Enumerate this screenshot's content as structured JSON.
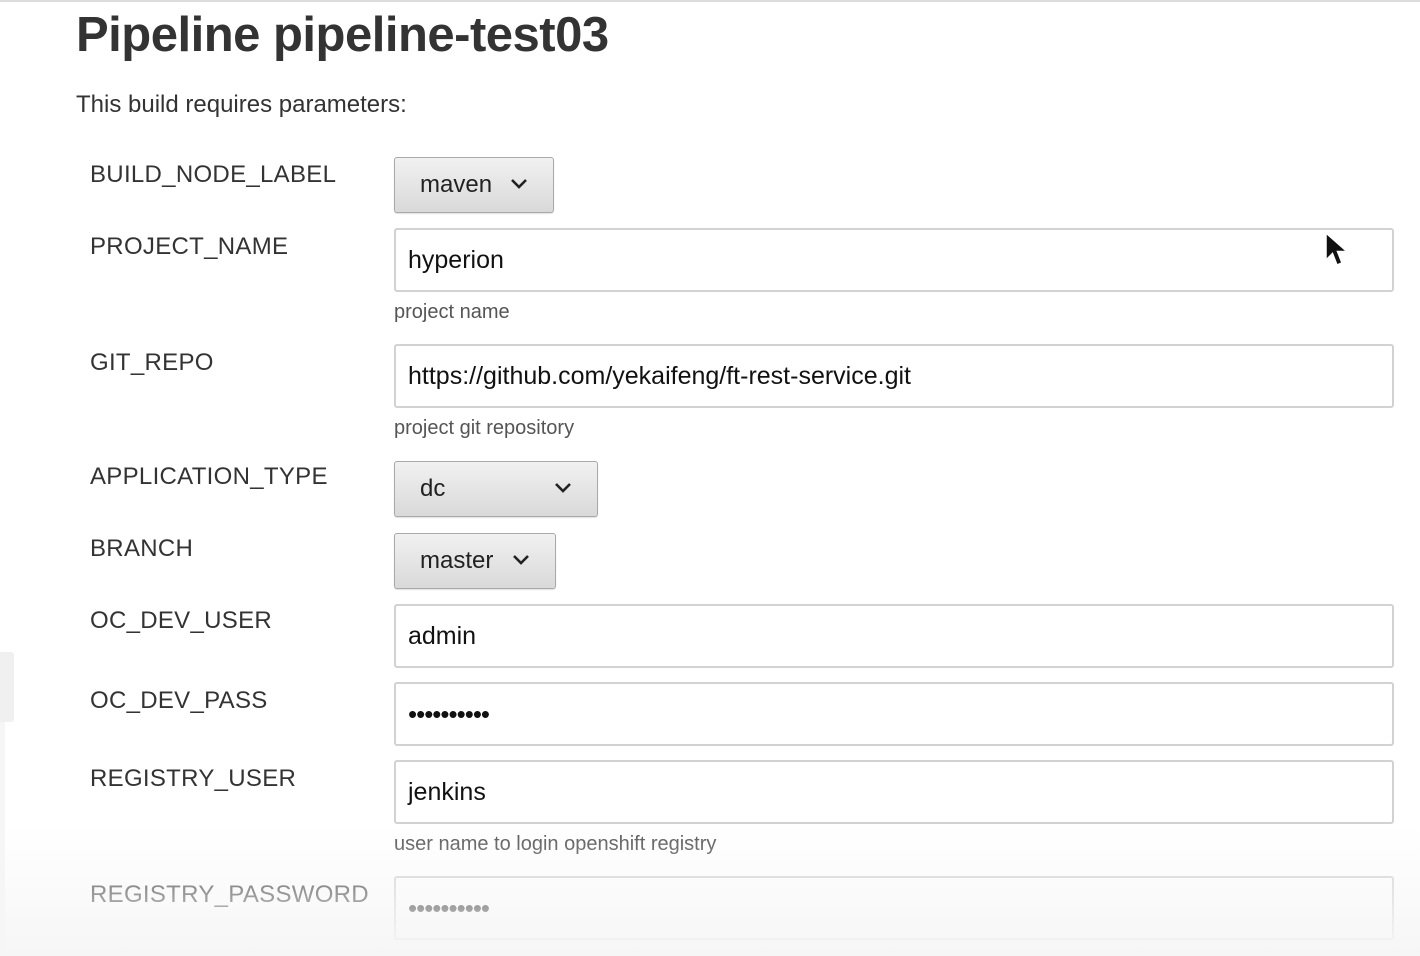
{
  "page": {
    "title": "Pipeline pipeline-test03",
    "subtitle": "This build requires parameters:"
  },
  "params": {
    "build_node_label": {
      "name": "BUILD_NODE_LABEL",
      "value": "maven",
      "icon": "chevron-down-icon"
    },
    "project_name": {
      "name": "PROJECT_NAME",
      "value": "hyperion",
      "description": "project name"
    },
    "git_repo": {
      "name": "GIT_REPO",
      "value": "https://github.com/yekaifeng/ft-rest-service.git",
      "description": "project git repository"
    },
    "application_type": {
      "name": "APPLICATION_TYPE",
      "value": "dc",
      "icon": "chevron-down-icon"
    },
    "branch": {
      "name": "BRANCH",
      "value": "master",
      "icon": "chevron-down-icon"
    },
    "oc_dev_user": {
      "name": "OC_DEV_USER",
      "value": "admin"
    },
    "oc_dev_pass": {
      "name": "OC_DEV_PASS",
      "value": "••••••••••"
    },
    "registry_user": {
      "name": "REGISTRY_USER",
      "value": "jenkins",
      "description": "user name to login openshift registry"
    },
    "registry_password": {
      "name": "REGISTRY_PASSWORD",
      "value": "••••••••••"
    }
  },
  "colors": {
    "text": "#333333",
    "button_top": "#f1f1f1",
    "button_bottom": "#d9d9d9",
    "input_border": "#d2d2d2"
  }
}
